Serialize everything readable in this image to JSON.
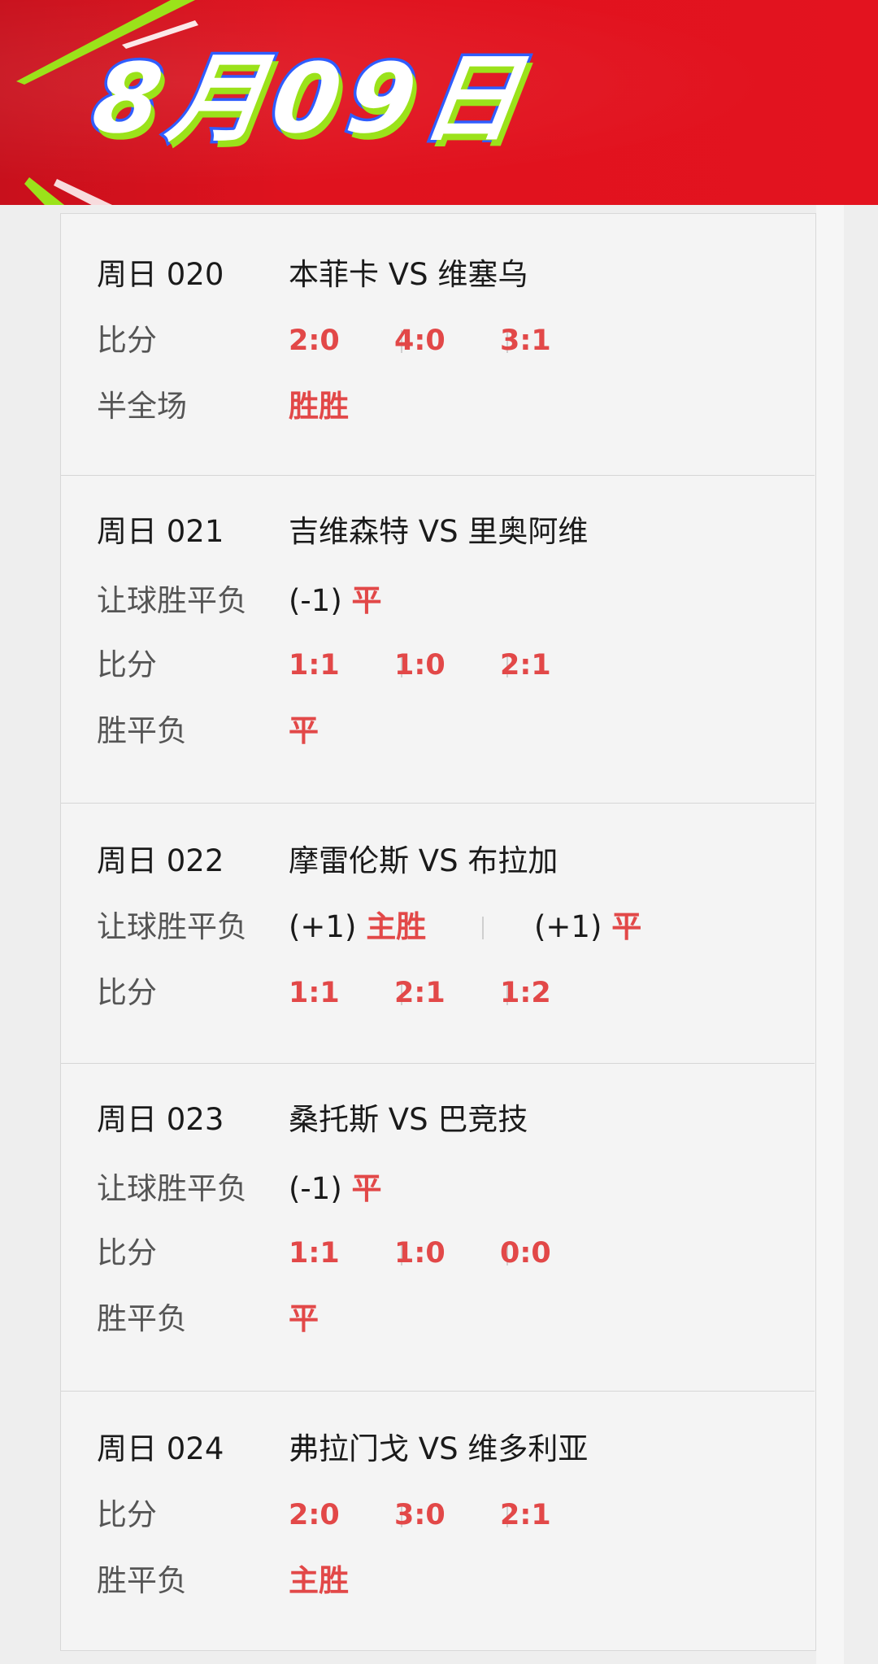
{
  "header": {
    "date": "8月09日"
  },
  "matches": [
    {
      "id": "周日 020",
      "teams": "本菲卡  VS  维塞乌",
      "score_label": "比分",
      "scores": [
        "2:0",
        "4:0",
        "3:1"
      ],
      "halffull_label": "半全场",
      "halffull": "胜胜"
    },
    {
      "id": "周日 021",
      "teams": "吉维森特  VS  里奥阿维",
      "handicap_label": "让球胜平负",
      "handicap": [
        {
          "line": "(-1)",
          "pick": "平"
        }
      ],
      "score_label": "比分",
      "scores": [
        "1:1",
        "1:0",
        "2:1"
      ],
      "wdl_label": "胜平负",
      "wdl": "平"
    },
    {
      "id": "周日 022",
      "teams": "摩雷伦斯  VS  布拉加",
      "handicap_label": "让球胜平负",
      "handicap": [
        {
          "line": "(+1)",
          "pick": "主胜"
        },
        {
          "line": "(+1)",
          "pick": "平"
        }
      ],
      "score_label": "比分",
      "scores": [
        "1:1",
        "2:1",
        "1:2"
      ]
    },
    {
      "id": "周日 023",
      "teams": "桑托斯  VS  巴竞技",
      "handicap_label": "让球胜平负",
      "handicap": [
        {
          "line": "(-1)",
          "pick": "平"
        }
      ],
      "score_label": "比分",
      "scores": [
        "1:1",
        "1:0",
        "0:0"
      ],
      "wdl_label": "胜平负",
      "wdl": "平"
    },
    {
      "id": "周日 024",
      "teams": "弗拉门戈  VS  维多利亚",
      "score_label": "比分",
      "scores": [
        "2:0",
        "3:0",
        "2:1"
      ],
      "wdl_label": "胜平负",
      "wdl": "主胜"
    }
  ],
  "colors": {
    "banner": "#e3131f",
    "accent_red": "#e24848",
    "title_stroke": "#2f5dff",
    "title_shadow": "#9be21a"
  }
}
